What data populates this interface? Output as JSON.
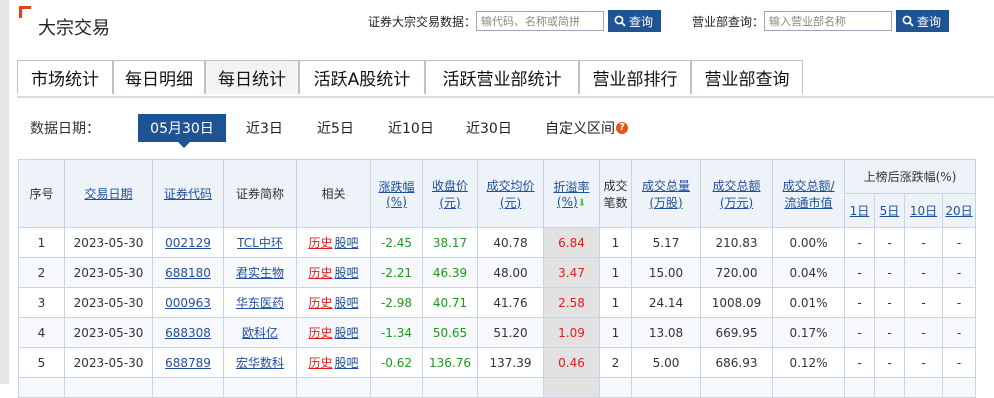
{
  "page": {
    "title": "大宗交易"
  },
  "search_stock": {
    "label": "证券大宗交易数据：",
    "placeholder": "输代码、名称或简拼",
    "button": "查询"
  },
  "search_branch": {
    "label": "营业部查询：",
    "placeholder": "输入营业部名称",
    "button": "查询"
  },
  "tabs": [
    "市场统计",
    "每日明细",
    "每日统计",
    "活跃A股统计",
    "活跃营业部统计",
    "营业部排行",
    "营业部查询"
  ],
  "active_tab": "每日统计",
  "date_filter": {
    "label": "数据日期：",
    "options": [
      "05月30日",
      "近3日",
      "近5日",
      "近10日",
      "近30日",
      "自定义区间"
    ],
    "selected": "05月30日",
    "help_icon": "?"
  },
  "table": {
    "headers": {
      "seq": "序号",
      "date": "交易日期",
      "code": "证券代码",
      "name": "证券简称",
      "related": "相关",
      "change_l1": "涨跌幅",
      "change_l2": "(%)",
      "close_l1": "收盘价",
      "close_l2": "(元)",
      "avg_l1": "成交均价",
      "avg_l2": "(元)",
      "premium_l1": "折溢率",
      "premium_l2": "(%)",
      "count_l1": "成交",
      "count_l2": "笔数",
      "vol_l1": "成交总量",
      "vol_l2": "(万股)",
      "amt_l1": "成交总额",
      "amt_l2": "(万元)",
      "ratio_l1": "成交总额/",
      "ratio_l2": "流通市值",
      "after": "上榜后涨跌幅(%)",
      "d1": "1日",
      "d5": "5日",
      "d10": "10日",
      "d20": "20日"
    },
    "rows": [
      {
        "seq": "1",
        "date": "2023-05-30",
        "code": "002129",
        "name": "TCL中环",
        "hist": "历史",
        "bar": "股吧",
        "change": "-2.45",
        "close": "38.17",
        "avg": "40.78",
        "premium": "6.84",
        "count": "1",
        "vol": "5.17",
        "amt": "210.83",
        "ratio": "0.00%",
        "d1": "-",
        "d5": "-",
        "d10": "-",
        "d20": "-"
      },
      {
        "seq": "2",
        "date": "2023-05-30",
        "code": "688180",
        "name": "君实生物",
        "hist": "历史",
        "bar": "股吧",
        "change": "-2.21",
        "close": "46.39",
        "avg": "48.00",
        "premium": "3.47",
        "count": "1",
        "vol": "15.00",
        "amt": "720.00",
        "ratio": "0.04%",
        "d1": "-",
        "d5": "-",
        "d10": "-",
        "d20": "-"
      },
      {
        "seq": "3",
        "date": "2023-05-30",
        "code": "000963",
        "name": "华东医药",
        "hist": "历史",
        "bar": "股吧",
        "change": "-2.98",
        "close": "40.71",
        "avg": "41.76",
        "premium": "2.58",
        "count": "1",
        "vol": "24.14",
        "amt": "1008.09",
        "ratio": "0.01%",
        "d1": "-",
        "d5": "-",
        "d10": "-",
        "d20": "-"
      },
      {
        "seq": "4",
        "date": "2023-05-30",
        "code": "688308",
        "name": "欧科亿",
        "hist": "历史",
        "bar": "股吧",
        "change": "-1.34",
        "close": "50.65",
        "avg": "51.20",
        "premium": "1.09",
        "count": "1",
        "vol": "13.08",
        "amt": "669.95",
        "ratio": "0.17%",
        "d1": "-",
        "d5": "-",
        "d10": "-",
        "d20": "-"
      },
      {
        "seq": "5",
        "date": "2023-05-30",
        "code": "688789",
        "name": "宏华数科",
        "hist": "历史",
        "bar": "股吧",
        "change": "-0.62",
        "close": "136.76",
        "avg": "137.39",
        "premium": "0.46",
        "count": "2",
        "vol": "5.00",
        "amt": "686.93",
        "ratio": "0.12%",
        "d1": "-",
        "d5": "-",
        "d10": "-",
        "d20": "-"
      }
    ]
  },
  "colors": {
    "brand": "#1f5494",
    "accent": "#e3401b",
    "up": "#e01e1e",
    "down": "#1a9a1a",
    "link": "#1f4f9d"
  }
}
